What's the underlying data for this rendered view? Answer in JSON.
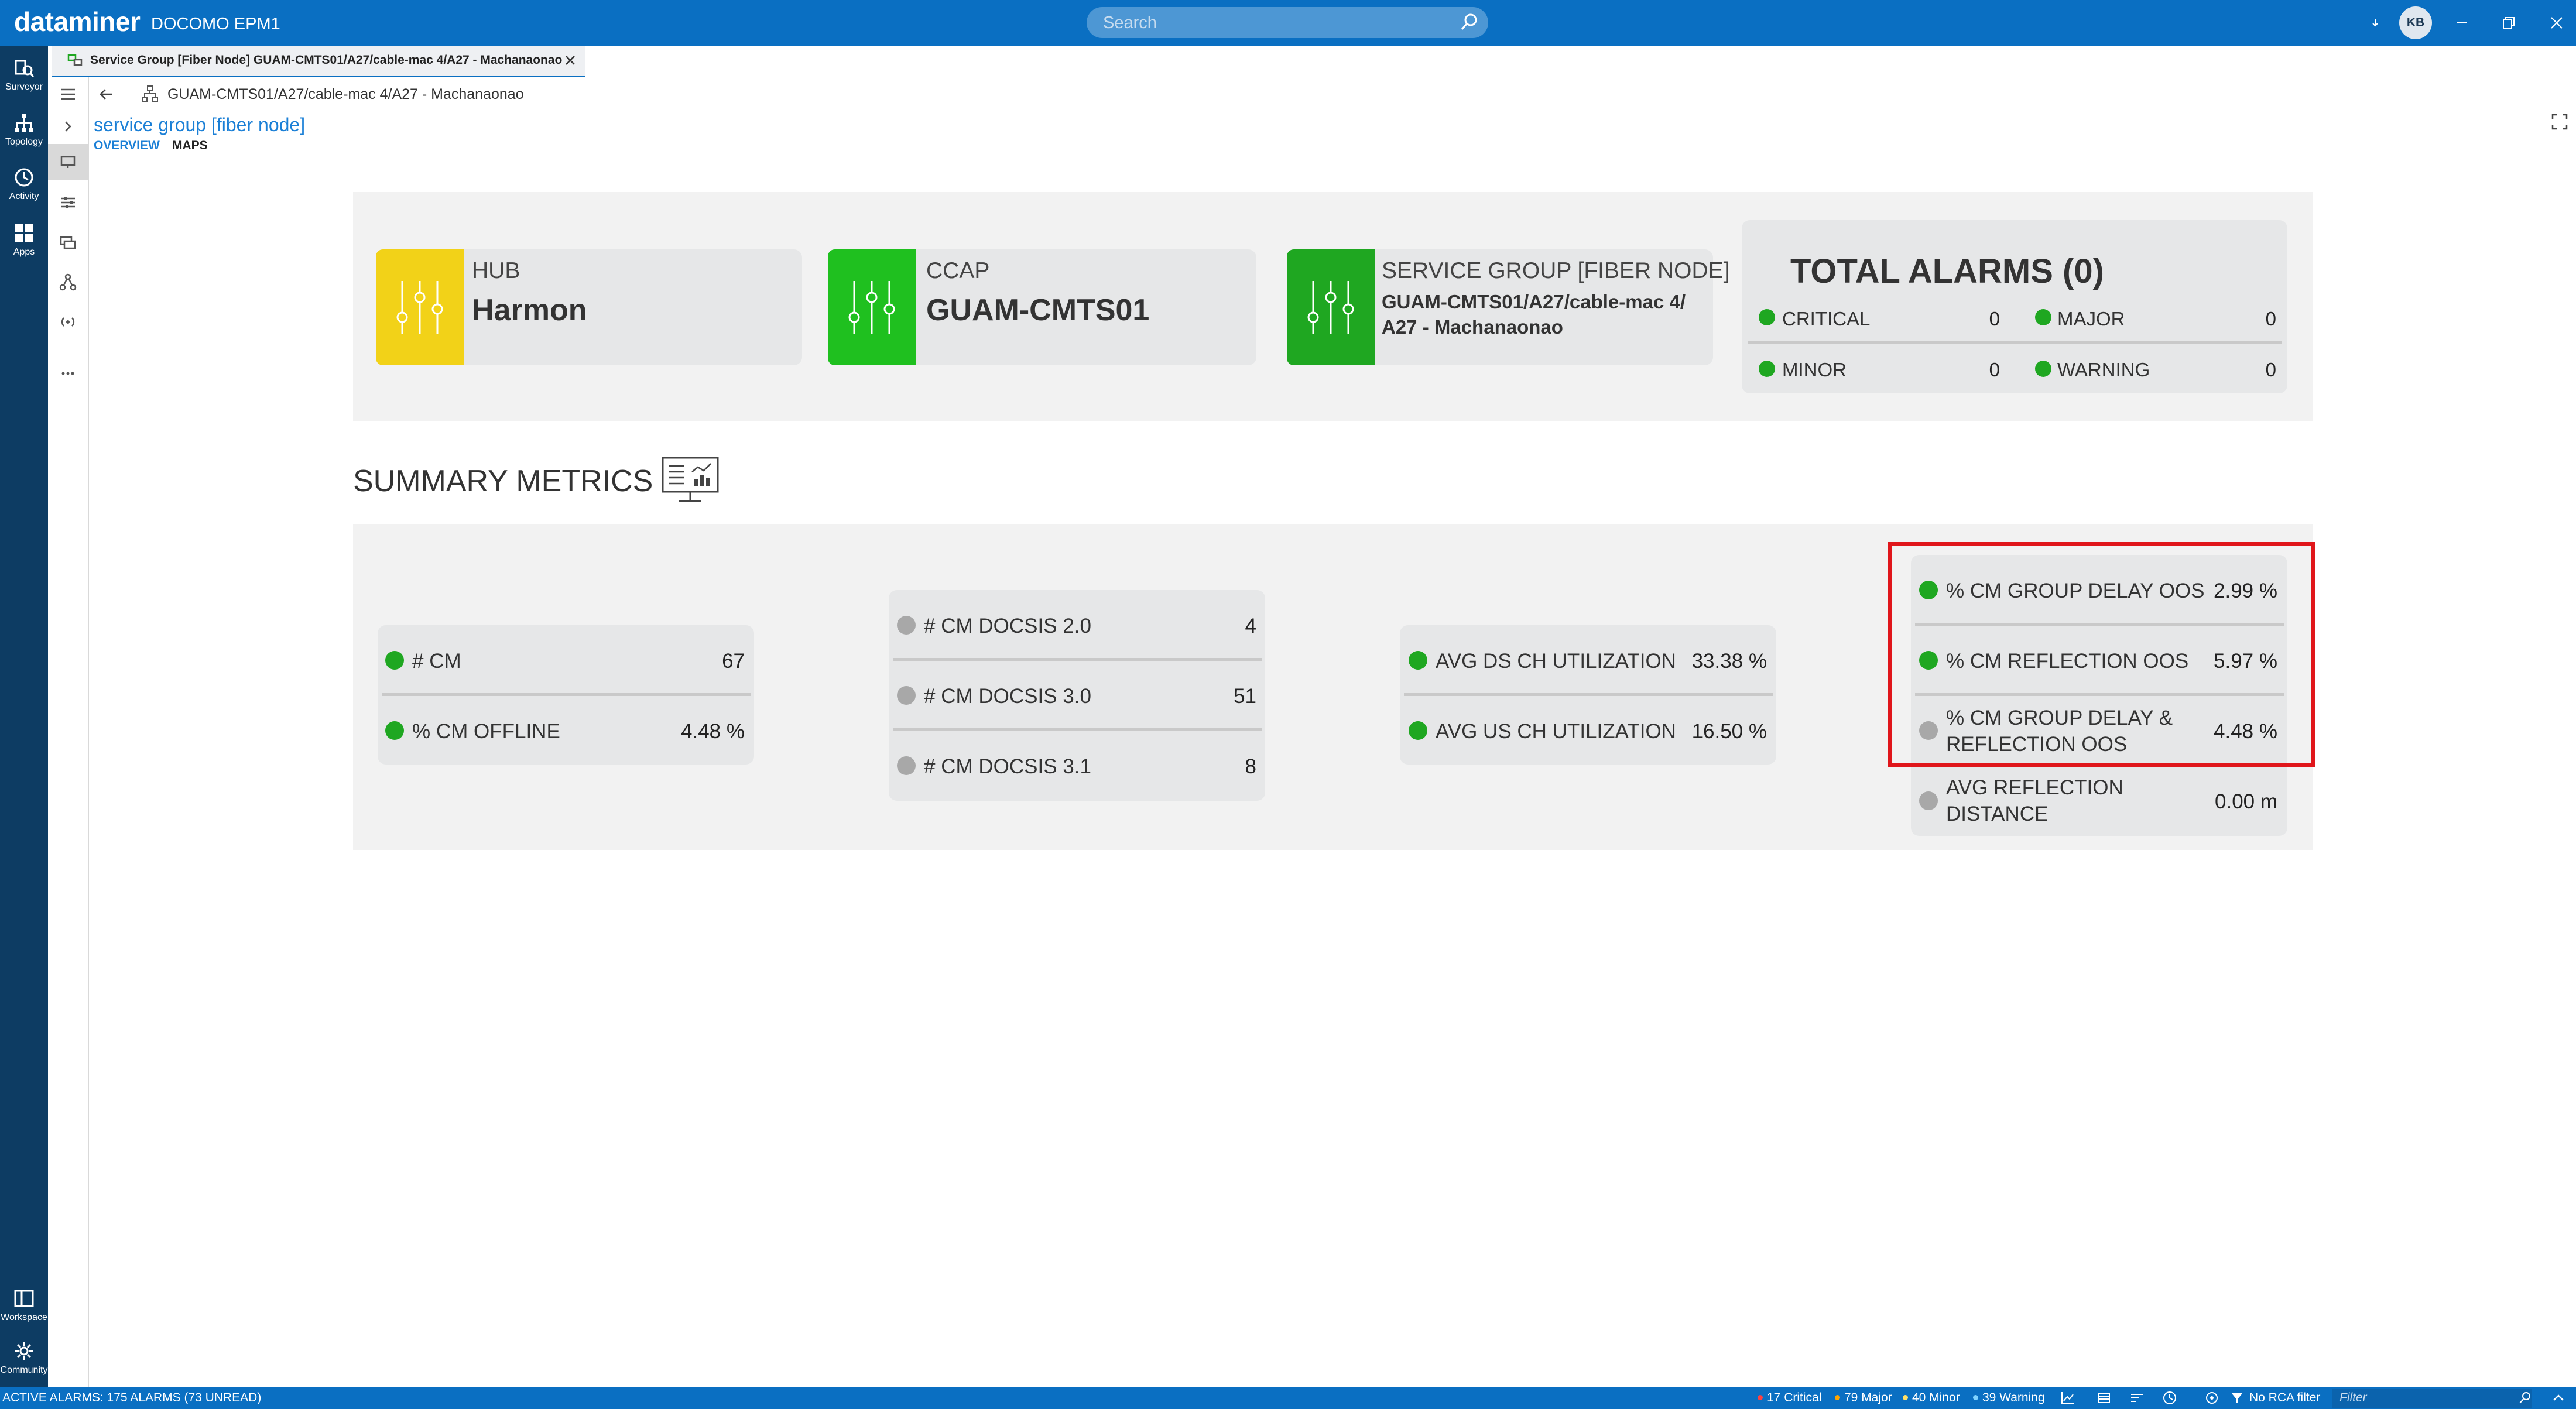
{
  "app": {
    "logo": "dataminer",
    "system": "DOCOMO EPM1",
    "avatar": "KB"
  },
  "search": {
    "placeholder": "Search"
  },
  "rail": {
    "items": [
      {
        "label": "Surveyor"
      },
      {
        "label": "Topology"
      },
      {
        "label": "Activity"
      },
      {
        "label": "Apps"
      },
      {
        "label": "Workspace"
      },
      {
        "label": "Community"
      }
    ]
  },
  "tab": {
    "title": "Service Group [Fiber Node] GUAM-CMTS01/A27/cable-mac 4/A27 - Machanaonao"
  },
  "breadcrumb": {
    "path": "GUAM-CMTS01/A27/cable-mac 4/A27 - Machanaonao"
  },
  "page": {
    "link": "service group [fiber node]",
    "tabs": {
      "overview": "OVERVIEW",
      "maps": "MAPS"
    }
  },
  "cards": {
    "hub": {
      "label": "HUB",
      "value": "Harmon",
      "color": "#f2d218"
    },
    "ccap": {
      "label": "CCAP",
      "value": "GUAM-CMTS01",
      "color": "#1fc01f"
    },
    "sg": {
      "label": "SERVICE GROUP [FIBER NODE]",
      "value_line1": "GUAM-CMTS01/A27/cable-mac 4/",
      "value_line2": "A27 - Machanaonao",
      "color": "#1fa721"
    }
  },
  "alarms": {
    "title": "TOTAL ALARMS (0)",
    "critical": {
      "label": "CRITICAL",
      "value": "0"
    },
    "major": {
      "label": "MAJOR",
      "value": "0"
    },
    "minor": {
      "label": "MINOR",
      "value": "0"
    },
    "warning": {
      "label": "WARNING",
      "value": "0"
    }
  },
  "summary": {
    "title": "SUMMARY METRICS"
  },
  "metrics": {
    "cm": {
      "label": "# CM",
      "value": "67"
    },
    "cm_offline": {
      "label": "% CM OFFLINE",
      "value": "4.48 %"
    },
    "docsis20": {
      "label": "# CM DOCSIS 2.0",
      "value": "4"
    },
    "docsis30": {
      "label": "# CM DOCSIS 3.0",
      "value": "51"
    },
    "docsis31": {
      "label": "# CM DOCSIS 3.1",
      "value": "8"
    },
    "avg_ds": {
      "label": "AVG DS CH UTILIZATION",
      "value": "33.38 %"
    },
    "avg_us": {
      "label": "AVG US CH UTILIZATION",
      "value": "16.50 %"
    },
    "group_delay": {
      "label": "% CM GROUP DELAY OOS",
      "value": "2.99 %"
    },
    "reflection": {
      "label": "% CM REFLECTION OOS",
      "value": "5.97 %"
    },
    "gd_refl_line1": {
      "label": "% CM GROUP DELAY &"
    },
    "gd_refl_line2": {
      "label": "REFLECTION OOS"
    },
    "gd_refl": {
      "value": "4.48 %"
    },
    "avg_refl_line1": {
      "label": "AVG REFLECTION"
    },
    "avg_refl_line2": {
      "label": "DISTANCE"
    },
    "avg_refl": {
      "value": "0.00 m"
    }
  },
  "status": {
    "active": "ACTIVE ALARMS: 175 ALARMS (73 UNREAD)",
    "critical": "17 Critical",
    "major": "79 Major",
    "minor": "40 Minor",
    "warning": "39 Warning",
    "rca": "No RCA filter",
    "filter_placeholder": "Filter"
  },
  "colors": {
    "accent": "#0a6fc2",
    "highlight": "#e0161b",
    "ok": "#1fa721"
  }
}
